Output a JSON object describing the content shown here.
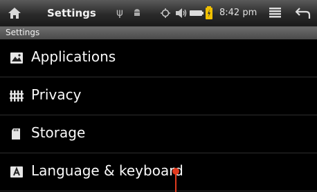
{
  "statusbar": {
    "title": "Settings",
    "time": "8:42 pm",
    "icons": [
      "home-icon",
      "usb-icon",
      "android-debug-icon",
      "gps-icon",
      "volume-icon",
      "battery-icon",
      "charging-icon",
      "menu-icon",
      "back-icon"
    ]
  },
  "subheader": {
    "title": "Settings"
  },
  "settings_items": [
    {
      "label": "Applications",
      "icon": "applications-icon"
    },
    {
      "label": "Privacy",
      "icon": "privacy-icon"
    },
    {
      "label": "Storage",
      "icon": "storage-icon"
    },
    {
      "label": "Language & keyboard",
      "icon": "language-keyboard-icon"
    }
  ],
  "colors": {
    "marker": "#e03a1e",
    "battery_charge": "#f0c000"
  }
}
